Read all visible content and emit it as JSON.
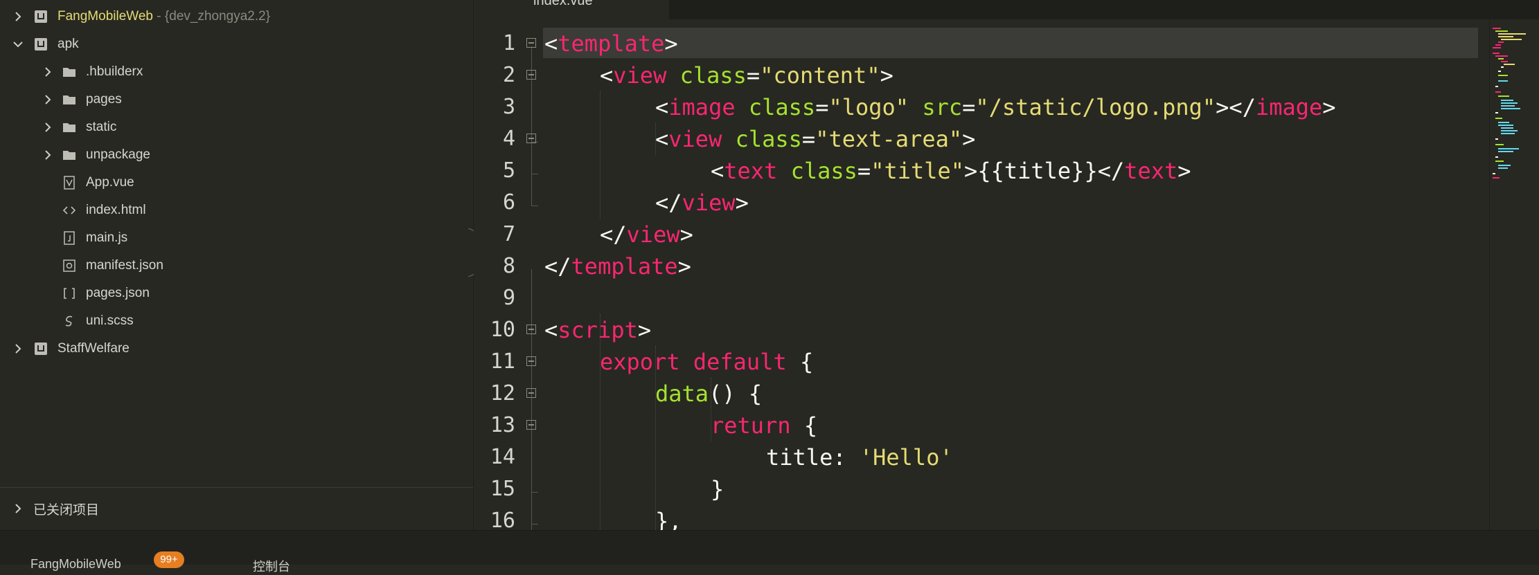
{
  "sidebar": {
    "projects": [
      {
        "name": "FangMobileWeb",
        "branch": "- {dev_zhongya2.2}"
      },
      {
        "name": "apk"
      },
      {
        "name": "StaffWelfare"
      }
    ],
    "apk_children": [
      {
        "label": ".hbuilderx",
        "icon": "folder-icon"
      },
      {
        "label": "pages",
        "icon": "folder-icon"
      },
      {
        "label": "static",
        "icon": "folder-icon"
      },
      {
        "label": "unpackage",
        "icon": "folder-icon"
      },
      {
        "label": "App.vue",
        "icon": "vue-file-icon"
      },
      {
        "label": "index.html",
        "icon": "html-file-icon"
      },
      {
        "label": "main.js",
        "icon": "js-file-icon"
      },
      {
        "label": "manifest.json",
        "icon": "manifest-file-icon"
      },
      {
        "label": "pages.json",
        "icon": "json-file-icon"
      },
      {
        "label": "uni.scss",
        "icon": "scss-file-icon"
      }
    ],
    "closed_projects_label": "已关闭项目"
  },
  "editor": {
    "active_tab": "index.vue",
    "current_line": 1,
    "line_numbers": [
      "1",
      "2",
      "3",
      "4",
      "5",
      "6",
      "7",
      "8",
      "9",
      "10",
      "11",
      "12",
      "13",
      "14",
      "15",
      "16"
    ]
  },
  "bottom_panel": {
    "tab1": "FangMobileWeb",
    "badge": "99+",
    "tab2": "控制台"
  },
  "colors": {
    "background": "#272822",
    "tag": "#f92672",
    "attr": "#a6e22e",
    "string": "#e6db74",
    "text": "#f8f8f2",
    "badge": "#e67e22"
  }
}
